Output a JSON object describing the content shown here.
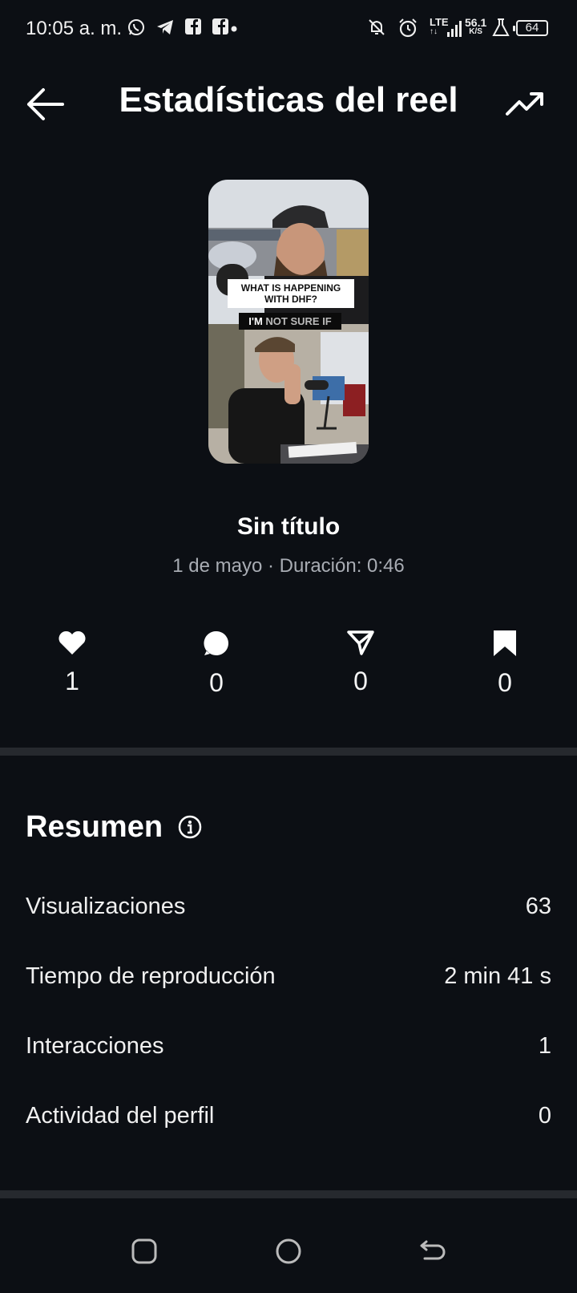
{
  "status_bar": {
    "time": "10:05 a. m.",
    "network": "LTE",
    "speed_value": "56.1",
    "speed_unit": "K/S",
    "battery": "64",
    "left_icons": [
      "whatsapp-icon",
      "telegram-icon",
      "facebook-icon",
      "facebook-icon"
    ],
    "right_icons": [
      "bell-off-icon",
      "alarm-icon",
      "signal-icon",
      "flask-icon",
      "battery-icon"
    ]
  },
  "header": {
    "title": "Estadísticas del reel",
    "back_icon": "arrow-left-icon",
    "trend_icon": "trending-up-icon"
  },
  "reel": {
    "caption_line1": "WHAT IS HAPPENING",
    "caption_line2": "WITH DHF?",
    "subtitle_a": "I'M",
    "subtitle_b": "NOT SURE IF",
    "title": "Sin título",
    "meta": "1 de mayo · Duración: 0:46"
  },
  "metrics": [
    {
      "icon": "heart-icon",
      "value": "1"
    },
    {
      "icon": "comment-icon",
      "value": "0"
    },
    {
      "icon": "send-icon",
      "value": "0"
    },
    {
      "icon": "bookmark-icon",
      "value": "0"
    }
  ],
  "summary": {
    "title": "Resumen",
    "rows": [
      {
        "label": "Visualizaciones",
        "value": "63"
      },
      {
        "label": "Tiempo de reproducción",
        "value": "2 min 41 s"
      },
      {
        "label": "Interacciones",
        "value": "1"
      },
      {
        "label": "Actividad del perfil",
        "value": "0"
      }
    ]
  },
  "colors": {
    "background": "#0c0f14",
    "divider": "#26292e",
    "text_secondary": "#a8acb3"
  }
}
